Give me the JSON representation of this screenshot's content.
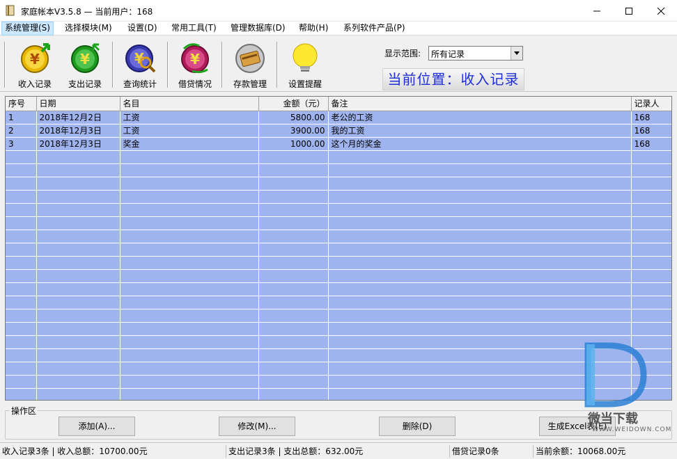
{
  "window": {
    "title": "家庭帐本V3.5.8  —  当前用户：168",
    "minimize_icon": "minimize-icon",
    "maximize_icon": "maximize-icon",
    "close_icon": "close-icon"
  },
  "menu": [
    {
      "label": "系统管理(S)",
      "active": true
    },
    {
      "label": "选择模块(M)"
    },
    {
      "label": "设置(D)"
    },
    {
      "label": "常用工具(T)"
    },
    {
      "label": "管理数据库(D)"
    },
    {
      "label": "帮助(H)"
    },
    {
      "label": "系列软件产品(P)"
    }
  ],
  "toolbar": {
    "buttons": [
      {
        "label": "收入记录",
        "icon": "income-coin-icon"
      },
      {
        "label": "支出记录",
        "icon": "expense-coin-icon"
      },
      {
        "label": "查询统计",
        "icon": "search-stats-icon"
      },
      {
        "label": "借贷情况",
        "icon": "loan-coin-icon"
      },
      {
        "label": "存款管理",
        "icon": "bankcard-icon"
      },
      {
        "label": "设置提醒",
        "icon": "lightbulb-icon"
      }
    ],
    "range_label": "显示范围:",
    "range_value": "所有记录",
    "location": "当前位置：收入记录"
  },
  "grid": {
    "columns": [
      "序号",
      "日期",
      "名目",
      "金额（元）",
      "备注",
      "记录人"
    ],
    "rows": [
      [
        "1",
        "2018年12月2日",
        "工资",
        "5800.00",
        "老公的工资",
        "168"
      ],
      [
        "2",
        "2018年12月3日",
        "工资",
        "3900.00",
        "我的工资",
        "168"
      ],
      [
        "3",
        "2018年12月3日",
        "奖金",
        "1000.00",
        "这个月的奖金",
        "168"
      ]
    ]
  },
  "ops": {
    "title": "操作区",
    "add": "添加(A)...",
    "edit": "修改(M)...",
    "delete": "删除(D)",
    "excel": "生成Excel表(E)"
  },
  "status": {
    "income": "收入记录3条  |  收入总额：10700.00元",
    "expense": "支出记录3条  |  支出总额：632.00元",
    "loan": "借贷记录0条",
    "balance": "当前余额：10068.00元"
  },
  "watermark": {
    "cn": "微当下载",
    "en": "WWW.WEIDOWN.COM"
  },
  "colors": {
    "grid_bg": "#9fb4ef",
    "location_text": "#1f2fd6"
  }
}
